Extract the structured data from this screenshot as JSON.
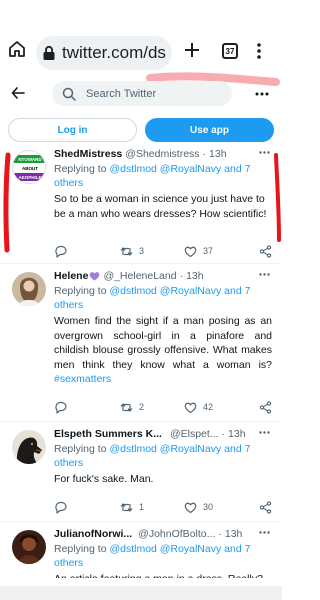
{
  "browser": {
    "url": "twitter.com/ds",
    "tab_count": "37"
  },
  "header": {
    "search_placeholder": "Search Twitter"
  },
  "auth": {
    "login_label": "Log in",
    "use_app_label": "Use app"
  },
  "tweets": [
    {
      "name": "ShedMistress",
      "handle": "@Shedmistress",
      "time": "13h",
      "reply_prefix": "Replying to ",
      "reply_mentions": "@dstlmod @RoyalNavy",
      "reply_and": " and 7 others",
      "text": "So to be a woman in science you just have to be a man who wears dresses? How scientific!",
      "replies": "",
      "retweets": "3",
      "likes": "37",
      "avatar_text": [
        "NTOWARD",
        "ABOUT",
        "AEOPHILE"
      ]
    },
    {
      "name": "Helene",
      "handle": "@_HeleneLand",
      "time": "13h",
      "reply_prefix": "Replying to ",
      "reply_mentions": "@dstlmod @RoyalNavy",
      "reply_and": " and 7 others",
      "text": "Women find the sight if a man posing as an overgrown school-girl in a pinafore and childish blouse grossly offensive. What makes men think they know what a woman is? ",
      "hashtag": "#sexmatters",
      "replies": "",
      "retweets": "2",
      "likes": "42"
    },
    {
      "name": "Elspeth Summers K...",
      "handle": "@Elspet...",
      "time": "13h",
      "reply_prefix": "Replying to ",
      "reply_mentions": "@dstlmod @RoyalNavy",
      "reply_and": " and 7 others",
      "text": "For fuck's sake. Man.",
      "replies": "",
      "retweets": "1",
      "likes": "30"
    },
    {
      "name": "JulianofNorwi...",
      "handle": "@JohnOfBolto...",
      "time": "13h",
      "reply_prefix": "Replying to ",
      "reply_mentions": "@dstlmod @RoyalNavy",
      "reply_and": " and 7 others",
      "text": "An article featuring a man in a dress. Really?"
    }
  ],
  "colors": {
    "accent": "#1d9bf0",
    "muted": "#536471",
    "text": "#0f1419",
    "annotation_red": "#e8141b",
    "heart_purple": "#a07ee0"
  },
  "icons": {
    "home": "home-icon",
    "lock": "lock-icon",
    "new_tab": "plus-icon",
    "menu": "more-vertical-icon",
    "back": "back-arrow-icon",
    "search": "search-icon",
    "more": "more-horizontal-icon",
    "reply": "reply-icon",
    "retweet": "retweet-icon",
    "like": "heart-icon",
    "share": "share-icon"
  }
}
